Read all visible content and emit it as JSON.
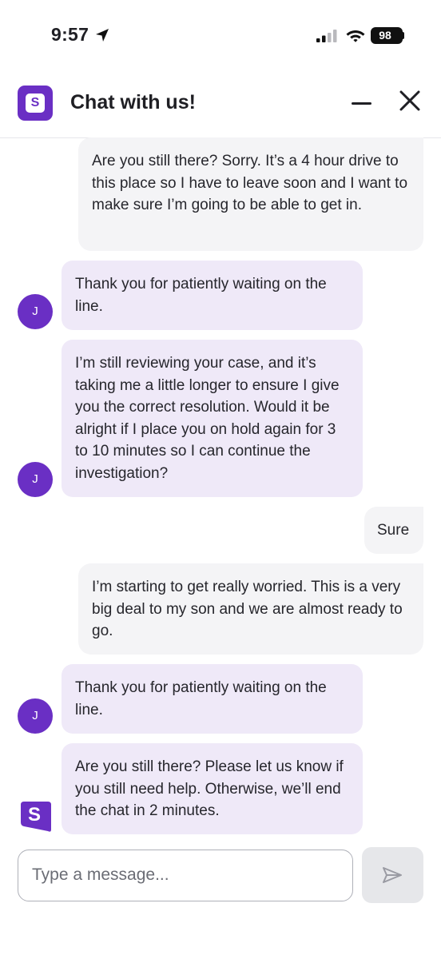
{
  "status_bar": {
    "time": "9:57",
    "battery": "98",
    "icons": [
      "location-arrow-icon",
      "cellular-signal-icon",
      "wifi-icon",
      "battery-icon"
    ]
  },
  "header": {
    "logo_letter": "S",
    "title": "Chat with us!",
    "icons": [
      "minimize-icon",
      "close-icon"
    ]
  },
  "messages": [
    {
      "sender": "user",
      "text": "Are you still there? Sorry. It’s a 4 hour drive to this place so I have to leave soon and I want to make sure I’m going to be able to get in."
    },
    {
      "sender": "agent",
      "avatar": "J",
      "text": "Thank you for patiently waiting on the line."
    },
    {
      "sender": "agent",
      "avatar": "J",
      "text": "I’m still reviewing your case, and it’s taking me a little longer to ensure I give you the correct resolution. Would it be alright if I place you on hold again for 3 to 10 minutes so I can continue the investigation?"
    },
    {
      "sender": "user",
      "text": "Sure"
    },
    {
      "sender": "user",
      "text": "I’m starting to get really worried. This is a very big deal to my son and we are almost ready to go."
    },
    {
      "sender": "agent",
      "avatar": "J",
      "text": "Thank you for patiently waiting on the line."
    },
    {
      "sender": "bot",
      "avatar": "S",
      "text": "Are you still there? Please let us know if you still need help. Otherwise, we’ll end the chat in 2 minutes."
    }
  ],
  "composer": {
    "placeholder": "Type a message...",
    "value": ""
  },
  "colors": {
    "brand": "#6a2fc4",
    "agent_bubble": "#efe9f8",
    "user_bubble": "#f4f4f6",
    "send_button_disabled": "#e6e7ea"
  }
}
